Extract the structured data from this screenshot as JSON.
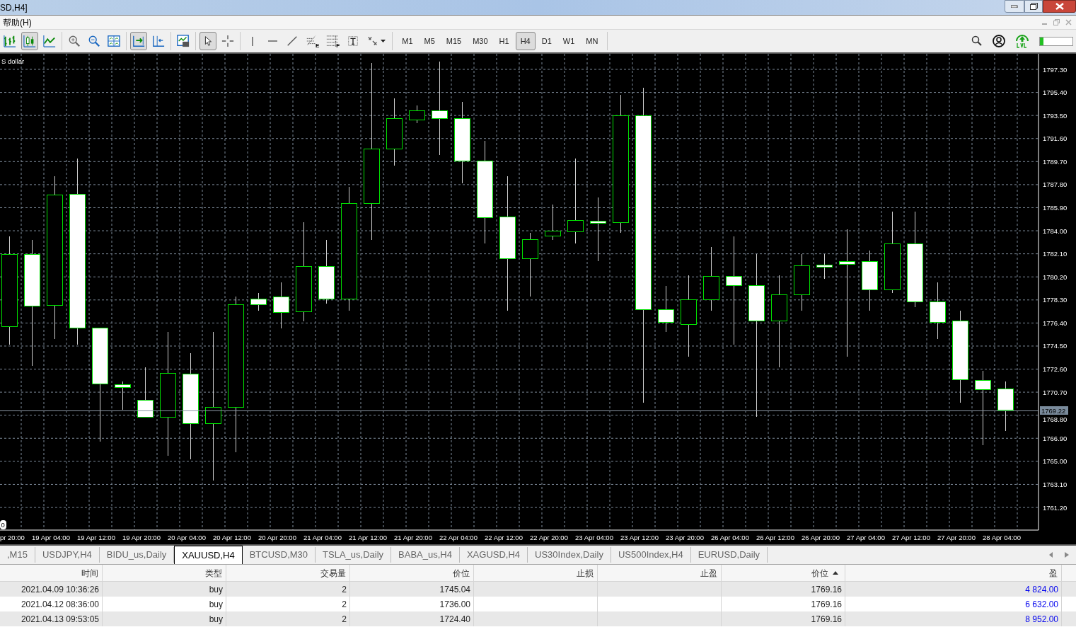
{
  "window": {
    "title": "SD,H4]"
  },
  "menu": [
    "帮助(H)"
  ],
  "tools": [
    {
      "kind": "bars",
      "pressed": false
    },
    {
      "kind": "candles",
      "pressed": true
    },
    {
      "kind": "line",
      "pressed": false
    },
    {
      "kind": "sep"
    },
    {
      "kind": "zoomin",
      "pressed": false
    },
    {
      "kind": "zoomout",
      "pressed": false
    },
    {
      "kind": "tile",
      "pressed": false
    },
    {
      "kind": "sep"
    },
    {
      "kind": "autoscroll",
      "pressed": true
    },
    {
      "kind": "shift",
      "pressed": false
    },
    {
      "kind": "sep"
    },
    {
      "kind": "template",
      "pressed": false
    },
    {
      "kind": "sep"
    },
    {
      "kind": "cursor",
      "pressed": true
    },
    {
      "kind": "crosshair",
      "pressed": false
    },
    {
      "kind": "sep"
    },
    {
      "kind": "vline",
      "pressed": false
    },
    {
      "kind": "hline",
      "pressed": false
    },
    {
      "kind": "trend",
      "pressed": false
    },
    {
      "kind": "fibo",
      "pressed": false,
      "letter": "E"
    },
    {
      "kind": "grid",
      "pressed": false,
      "letter": "F"
    },
    {
      "kind": "text",
      "pressed": false
    },
    {
      "kind": "shapes",
      "pressed": false
    }
  ],
  "timeframes": [
    {
      "label": "M1",
      "selected": false
    },
    {
      "label": "M5",
      "selected": false
    },
    {
      "label": "M15",
      "selected": false
    },
    {
      "label": "M30",
      "selected": false
    },
    {
      "label": "H1",
      "selected": false
    },
    {
      "label": "H4",
      "selected": true
    },
    {
      "label": "D1",
      "selected": false
    },
    {
      "label": "W1",
      "selected": false
    },
    {
      "label": "MN",
      "selected": false
    }
  ],
  "progress": {
    "level": 0.1
  },
  "chart": {
    "symbol_label": "S dollar",
    "corner_label": "0",
    "current_price": "1769.22",
    "price_ticks": [
      "1797.30",
      "1795.40",
      "1793.50",
      "1791.60",
      "1789.70",
      "1787.80",
      "1785.90",
      "1784.00",
      "1782.10",
      "1780.20",
      "1778.30",
      "1776.40",
      "1774.50",
      "1772.60",
      "1770.70",
      "1768.80",
      "1766.90",
      "1765.00",
      "1763.10",
      "1761.20"
    ],
    "time_labels": [
      "pr 20:00",
      "19 Apr 04:00",
      "19 Apr 12:00",
      "19 Apr 20:00",
      "20 Apr 04:00",
      "20 Apr 12:00",
      "20 Apr 20:00",
      "21 Apr 04:00",
      "21 Apr 12:00",
      "21 Apr 20:00",
      "22 Apr 04:00",
      "22 Apr 12:00",
      "22 Apr 20:00",
      "23 Apr 04:00",
      "23 Apr 12:00",
      "23 Apr 20:00",
      "26 Apr 04:00",
      "26 Apr 12:00",
      "26 Apr 20:00",
      "27 Apr 04:00",
      "27 Apr 12:00",
      "27 Apr 20:00",
      "28 Apr 04:00"
    ]
  },
  "chart_tabs": [
    {
      "label": ",M15",
      "selected": false
    },
    {
      "label": "USDJPY,H4",
      "selected": false
    },
    {
      "label": "BIDU_us,Daily",
      "selected": false
    },
    {
      "label": "XAUUSD,H4",
      "selected": true
    },
    {
      "label": "BTCUSD,M30",
      "selected": false
    },
    {
      "label": "TSLA_us,Daily",
      "selected": false
    },
    {
      "label": "BABA_us,H4",
      "selected": false
    },
    {
      "label": "XAGUSD,H4",
      "selected": false
    },
    {
      "label": "US30Index,Daily",
      "selected": false
    },
    {
      "label": "US500Index,H4",
      "selected": false
    },
    {
      "label": "EURUSD,Daily",
      "selected": false
    }
  ],
  "table": {
    "columns": [
      {
        "label": "时间",
        "sorted": false
      },
      {
        "label": "类型",
        "sorted": false
      },
      {
        "label": "交易量",
        "sorted": false
      },
      {
        "label": "价位",
        "sorted": false
      },
      {
        "label": "止损",
        "sorted": false
      },
      {
        "label": "止盈",
        "sorted": false
      },
      {
        "label": "价位",
        "sorted": true
      },
      {
        "label": "盈",
        "sorted": false
      }
    ],
    "rows": [
      {
        "cells": [
          "2021.04.09 10:36:26",
          "buy",
          "2",
          "1745.04",
          "",
          "",
          "1769.16",
          "4 824.00"
        ]
      },
      {
        "cells": [
          "2021.04.12 08:36:00",
          "buy",
          "2",
          "1736.00",
          "",
          "",
          "1769.16",
          "6 632.00"
        ]
      },
      {
        "cells": [
          "2021.04.13 09:53:05",
          "buy",
          "2",
          "1724.40",
          "",
          "",
          "1769.16",
          "8 952.00"
        ]
      }
    ]
  }
}
